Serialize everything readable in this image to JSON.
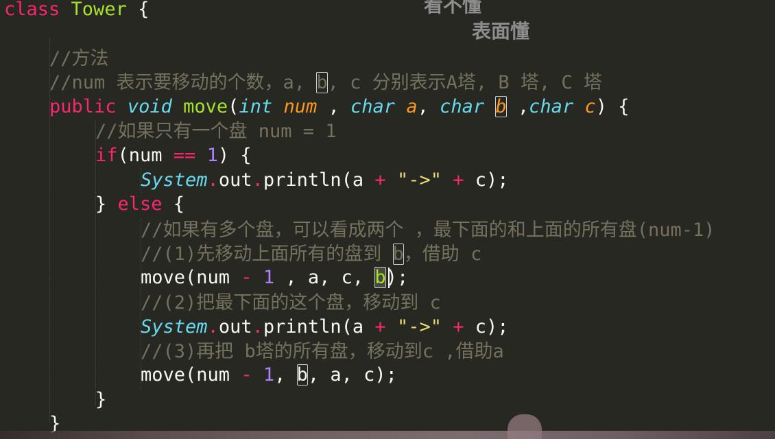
{
  "overlay": {
    "line1": "看不懂",
    "line2": "表面懂"
  },
  "code": {
    "l1_class": "class",
    "l1_name": "Tower",
    "l1_brace": " {",
    "l2": "//方法",
    "l3_a": "//num 表示要移动的个数，a, ",
    "l3_b": "b",
    "l3_c": ", c 分别表示A塔, B 塔, C 塔",
    "l4_public": "public",
    "l4_void": "void",
    "l4_move": "move",
    "l4_p1": "(",
    "l4_int": "int",
    "l4_num": "num",
    "l4_comma1": " , ",
    "l4_char1": "char",
    "l4_a": "a",
    "l4_comma2": ", ",
    "l4_char2": "char",
    "l4_b": "b",
    "l4_comma3": " ,",
    "l4_char3": "char",
    "l4_c": "c",
    "l4_end": ") {",
    "l5": "//如果只有一个盘 num = 1",
    "l6_if": "if",
    "l6_a": "(num ",
    "l6_eq": "==",
    "l6_sp": " ",
    "l6_one": "1",
    "l6_end": ") {",
    "l7_sys": "System",
    "l7_dot1": ".",
    "l7_out": "out",
    "l7_dot2": ".",
    "l7_println": "println(a ",
    "l7_plus1": "+",
    "l7_sp1": " ",
    "l7_str": "\"->\"",
    "l7_sp2": " ",
    "l7_plus2": "+",
    "l7_end": " c);",
    "l8_close": "} ",
    "l8_else": "else",
    "l8_open": " {",
    "l9": "//如果有多个盘，可以看成两个 ，最下面的和上面的所有盘(num-1)",
    "l10_a": "//(1)先移动上面所有的盘到 ",
    "l10_b": "b",
    "l10_c": "，借助 c",
    "l11_a": "move(num ",
    "l11_minus": "-",
    "l11_sp": " ",
    "l11_one": "1",
    "l11_b": " , a, c, ",
    "l11_hl": "b",
    "l11_end": ");",
    "l12": "//(2)把最下面的这个盘，移动到 c",
    "l13_sys": "System",
    "l13_dot1": ".",
    "l13_out": "out",
    "l13_dot2": ".",
    "l13_println": "println(a ",
    "l13_plus1": "+",
    "l13_sp1": " ",
    "l13_str": "\"->\"",
    "l13_sp2": " ",
    "l13_plus2": "+",
    "l13_end": " c);",
    "l14": "//(3)再把 b塔的所有盘，移动到c ,借助a",
    "l15_a": "move(num ",
    "l15_minus": "-",
    "l15_sp": " ",
    "l15_one": "1",
    "l15_comma": ", ",
    "l15_b": "b",
    "l15_end": ", a, c);",
    "l16": "}",
    "l17": "}"
  }
}
